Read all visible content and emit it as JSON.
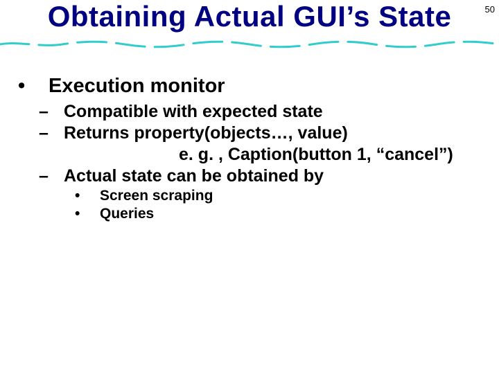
{
  "page_number": "50",
  "title": "Obtaining Actual GUI’s State",
  "bullets": {
    "lvl1": {
      "marker": "•",
      "text": "Execution monitor"
    },
    "lvl2": [
      {
        "marker": "–",
        "text": "Compatible with expected state"
      },
      {
        "marker": "–",
        "text": "Returns property(objects…, value)"
      },
      {
        "cont": "e. g. , Caption(button 1, “cancel”)"
      },
      {
        "marker": "–",
        "text": "Actual state can be obtained by"
      }
    ],
    "lvl3": [
      {
        "marker": "•",
        "text": "Screen scraping"
      },
      {
        "marker": "•",
        "text": "Queries"
      }
    ]
  },
  "colors": {
    "title": "#000080",
    "underline_stroke": "#33cccc",
    "text": "#000000"
  }
}
